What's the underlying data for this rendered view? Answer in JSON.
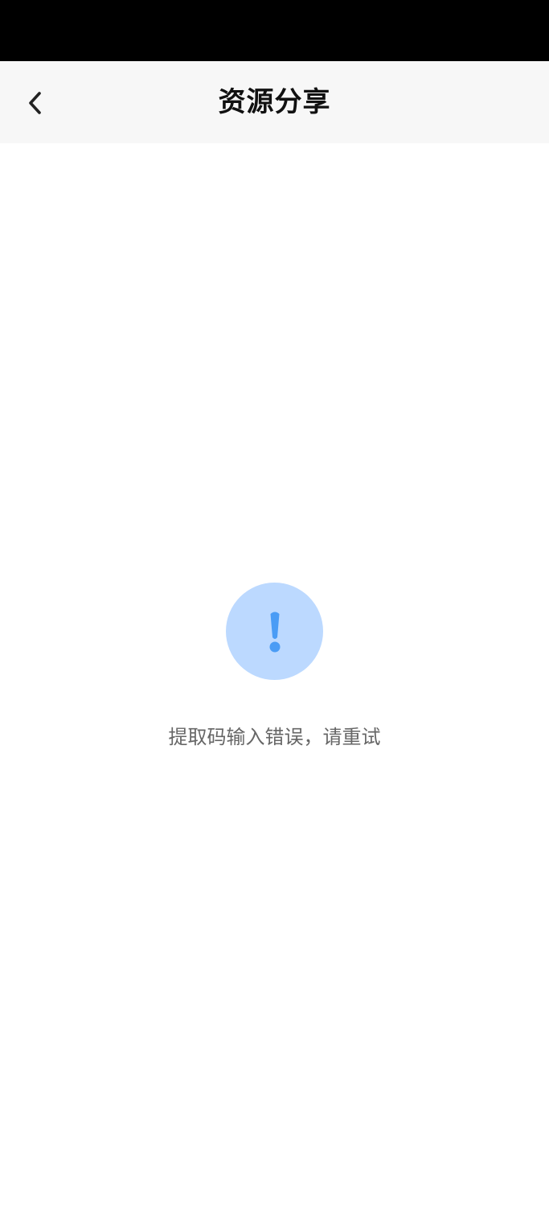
{
  "header": {
    "title": "资源分享",
    "back_icon": "chevron-left-icon"
  },
  "empty_state": {
    "icon": "exclamation-icon",
    "message": "提取码输入错误，请重试"
  },
  "colors": {
    "status_bar": "#000000",
    "nav_background": "#f7f7f7",
    "icon_circle": "#bcd9ff",
    "icon_mark": "#4a9cf5",
    "message_text": "#666666",
    "title_text": "#111111"
  }
}
